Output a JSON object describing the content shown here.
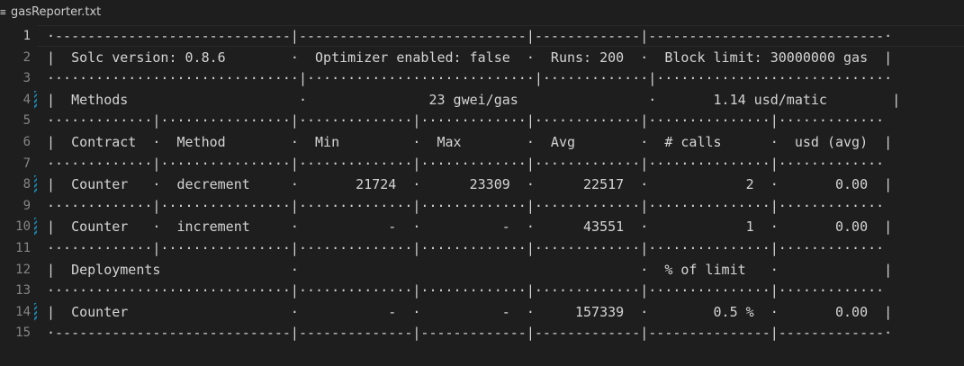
{
  "tab": {
    "file_icon": "≡",
    "title": "gasReporter.txt"
  },
  "editor": {
    "lines": [
      {
        "number": "1",
        "text": "·-----------------------------|----------------------------|-------------|-----------------------------·",
        "modified": false
      },
      {
        "number": "2",
        "text": "|  Solc version: 0.8.6        ·  Optimizer enabled: false  ·  Runs: 200  ·  Block limit: 30000000 gas  |",
        "modified": false
      },
      {
        "number": "3",
        "text": "·······························|····························|·············|·····························",
        "modified": false
      },
      {
        "number": "4",
        "text": "|  Methods                     ·               23 gwei/gas                ·       1.14 usd/matic        |",
        "modified": true
      },
      {
        "number": "5",
        "text": "·············|················|··············|·············|·············|···············|·············",
        "modified": false
      },
      {
        "number": "6",
        "text": "|  Contract  ·  Method        ·  Min         ·  Max        ·  Avg        ·  # calls      ·  usd (avg)  |",
        "modified": false
      },
      {
        "number": "7",
        "text": "·············|················|··············|·············|·············|···············|·············",
        "modified": false
      },
      {
        "number": "8",
        "text": "|  Counter   ·  decrement     ·       21724  ·      23309  ·      22517  ·            2  ·       0.00  |",
        "modified": true
      },
      {
        "number": "9",
        "text": "·············|················|··············|·············|·············|···············|·············",
        "modified": false
      },
      {
        "number": "10",
        "text": "|  Counter   ·  increment     ·           -  ·          -  ·      43551  ·            1  ·       0.00  |",
        "modified": true
      },
      {
        "number": "11",
        "text": "·············|················|··············|·············|·············|···············|·············",
        "modified": false
      },
      {
        "number": "12",
        "text": "|  Deployments                ·                                          ·  % of limit   ·             |",
        "modified": false
      },
      {
        "number": "13",
        "text": "······························|··············|·············|·············|···············|·············",
        "modified": false
      },
      {
        "number": "14",
        "text": "|  Counter                    ·           -  ·          -  ·     157339  ·        0.5 %  ·       0.00  |",
        "modified": true
      },
      {
        "number": "15",
        "text": "·-----------------------------|--------------|-------------|-------------|---------------|-------------·",
        "modified": false
      }
    ]
  }
}
